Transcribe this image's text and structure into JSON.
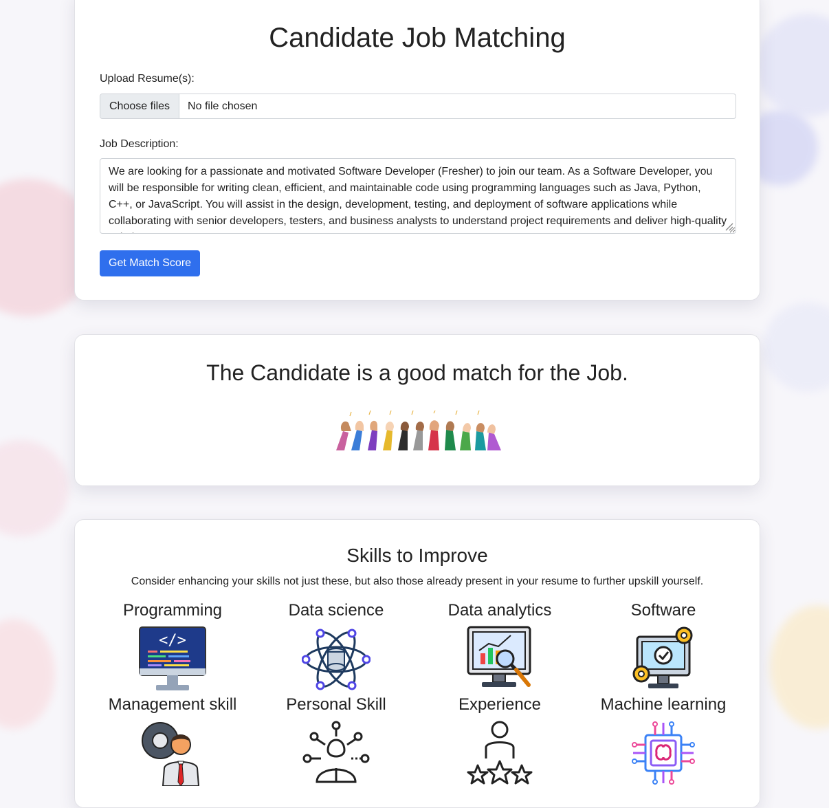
{
  "form": {
    "title": "Candidate Job Matching",
    "upload_label": "Upload Resume(s):",
    "choose_files": "Choose files",
    "no_file": "No file chosen",
    "jd_label": "Job Description:",
    "jd_text": "We are looking for a passionate and motivated Software Developer (Fresher) to join our team. As a Software Developer, you will be responsible for writing clean, efficient, and maintainable code using programming languages such as Java, Python, C++, or JavaScript. You will assist in the design, development, testing, and deployment of software applications while collaborating with senior developers, testers, and business analysts to understand project requirements and deliver high-quality solutions.",
    "submit": "Get Match Score"
  },
  "result": {
    "message": "The Candidate is a good match for the Job."
  },
  "skills": {
    "title": "Skills to Improve",
    "subtitle": "Consider enhancing your skills not just these, but also those already present in your resume to further upskill yourself.",
    "items": [
      {
        "name": "Programming",
        "icon": "programming-icon"
      },
      {
        "name": "Data science",
        "icon": "data-science-icon"
      },
      {
        "name": "Data analytics",
        "icon": "data-analytics-icon"
      },
      {
        "name": "Software",
        "icon": "software-icon"
      },
      {
        "name": "Management skill",
        "icon": "management-icon"
      },
      {
        "name": "Personal Skill",
        "icon": "personal-skill-icon"
      },
      {
        "name": "Experience",
        "icon": "experience-icon"
      },
      {
        "name": "Machine learning",
        "icon": "machine-learning-icon"
      }
    ]
  },
  "colors": {
    "primary": "#2f6fed",
    "page_bg": "#f7f6fa"
  }
}
